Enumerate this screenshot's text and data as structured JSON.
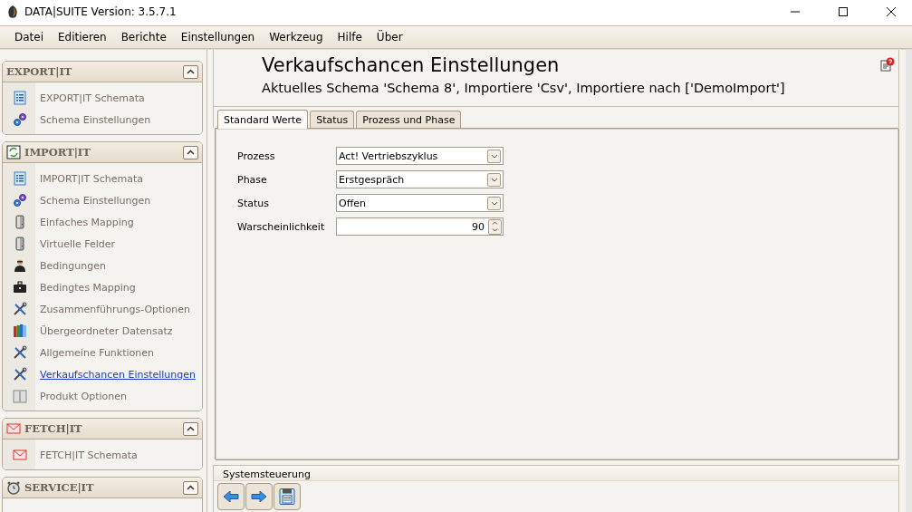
{
  "window": {
    "title": "DATA|SUITE Version: 3.5.7.1"
  },
  "menu": [
    "Datei",
    "Editieren",
    "Berichte",
    "Einstellungen",
    "Werkzeug",
    "Hilfe",
    "Über"
  ],
  "sidebar": {
    "groups": [
      {
        "title": "EXPORT|IT",
        "kind": "none",
        "expanded": true,
        "items": [
          {
            "label": "EXPORT|IT Schemata",
            "kind": "list",
            "selected": false
          },
          {
            "label": "Schema Einstellungen",
            "kind": "gears",
            "selected": false
          }
        ]
      },
      {
        "title": "IMPORT|IT",
        "kind": "sync",
        "expanded": true,
        "items": [
          {
            "label": "IMPORT|IT Schemata",
            "kind": "list",
            "selected": false
          },
          {
            "label": "Schema Einstellungen",
            "kind": "gears",
            "selected": false
          },
          {
            "label": "Einfaches Mapping",
            "kind": "server",
            "selected": false
          },
          {
            "label": "Virtuelle Felder",
            "kind": "server",
            "selected": false
          },
          {
            "label": "Bedingungen",
            "kind": "person",
            "selected": false
          },
          {
            "label": "Bedingtes Mapping",
            "kind": "briefcase",
            "selected": false
          },
          {
            "label": "Zusammenführungs-Optionen",
            "kind": "tools",
            "selected": false
          },
          {
            "label": "Übergeordneter Datensatz",
            "kind": "books",
            "selected": false
          },
          {
            "label": "Allgemeine Funktionen",
            "kind": "tools",
            "selected": false
          },
          {
            "label": "Verkaufschancen Einstellungen",
            "kind": "tools",
            "selected": true
          },
          {
            "label": "Produkt Optionen",
            "kind": "box",
            "selected": false
          }
        ]
      },
      {
        "title": "FETCH|IT",
        "kind": "mail",
        "expanded": true,
        "items": [
          {
            "label": "FETCH|IT Schemata",
            "kind": "mail",
            "selected": false
          }
        ]
      },
      {
        "title": "SERVICE|IT",
        "kind": "clock",
        "expanded": true
      }
    ]
  },
  "header": {
    "title": "Verkaufschancen Einstellungen",
    "subtitle": "Aktuelles Schema 'Schema 8', Importiere 'Csv', Importiere nach ['DemoImport']"
  },
  "tabs": [
    {
      "label": "Standard Werte",
      "selected": true
    },
    {
      "label": "Status",
      "selected": false
    },
    {
      "label": "Prozess und Phase",
      "selected": false
    }
  ],
  "form": [
    {
      "label": "Prozess",
      "kind": "select",
      "value": "Act! Vertriebszyklus"
    },
    {
      "label": "Phase",
      "kind": "select",
      "value": "Erstgespräch"
    },
    {
      "label": "Status",
      "kind": "select",
      "value": "Offen"
    },
    {
      "label": "Warscheinlichkeit",
      "kind": "spin",
      "value": "90"
    }
  ],
  "control_panel": {
    "title": "Systemsteuerung",
    "buttons": [
      {
        "kind": "back"
      },
      {
        "kind": "forward"
      },
      {
        "kind": "save"
      }
    ]
  }
}
